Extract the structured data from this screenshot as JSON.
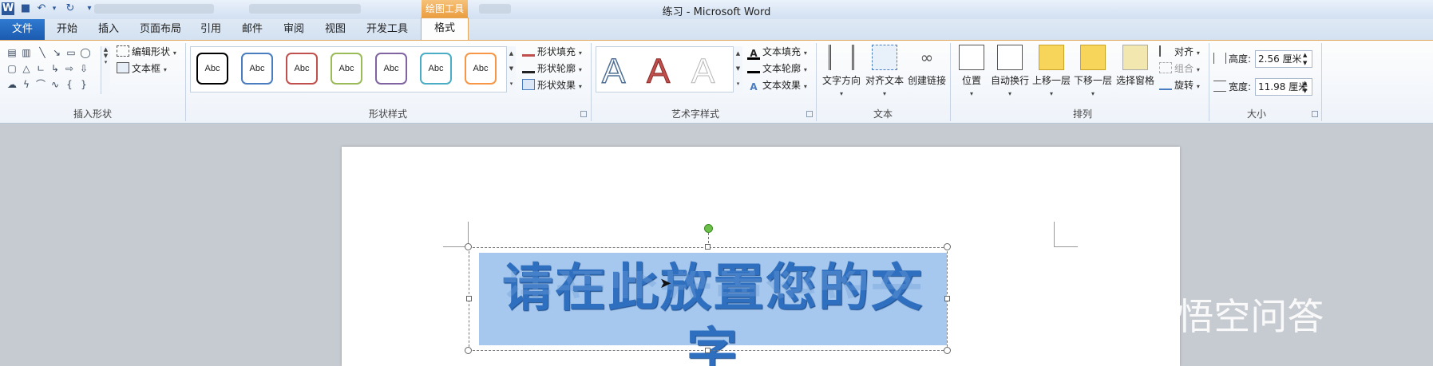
{
  "window": {
    "title": "练习 - Microsoft Word",
    "context_tab": "绘图工具"
  },
  "tabs": [
    "开始",
    "插入",
    "页面布局",
    "引用",
    "邮件",
    "审阅",
    "视图",
    "开发工具"
  ],
  "file_tab": "文件",
  "active_tab": "格式",
  "ribbon": {
    "insert_shapes": {
      "label": "插入形状",
      "edit_shape": "编辑形状",
      "text_box": "文本框"
    },
    "shape_styles": {
      "label": "形状样式",
      "gallery": [
        "Abc",
        "Abc",
        "Abc",
        "Abc",
        "Abc",
        "Abc",
        "Abc"
      ],
      "fill": "形状填充",
      "outline": "形状轮廓",
      "effects": "形状效果"
    },
    "wordart_styles": {
      "label": "艺术字样式",
      "gallery": [
        "A",
        "A",
        "A"
      ],
      "text_fill": "文本填充",
      "text_outline": "文本轮廓",
      "text_effects": "文本效果"
    },
    "text": {
      "label": "文本",
      "direction": "文字方向",
      "align": "对齐文本",
      "link": "创建链接"
    },
    "arrange": {
      "label": "排列",
      "position": "位置",
      "wrap": "自动换行",
      "bring_forward": "上移一层",
      "send_backward": "下移一层",
      "selection_pane": "选择窗格",
      "align": "对齐",
      "group": "组合",
      "rotate": "旋转"
    },
    "size": {
      "label": "大小",
      "height_label": "高度:",
      "height_value": "2.56 厘米",
      "width_label": "宽度:",
      "width_value": "11.98 厘米"
    }
  },
  "document": {
    "wordart_text": "请在此放置您的文字"
  },
  "watermark": "悟空问答",
  "colors": {
    "file_tab": "#2b68c0",
    "context_tab": "#e9a040",
    "wordart": "#2f6fbf",
    "selection": "#a6c8ee"
  }
}
